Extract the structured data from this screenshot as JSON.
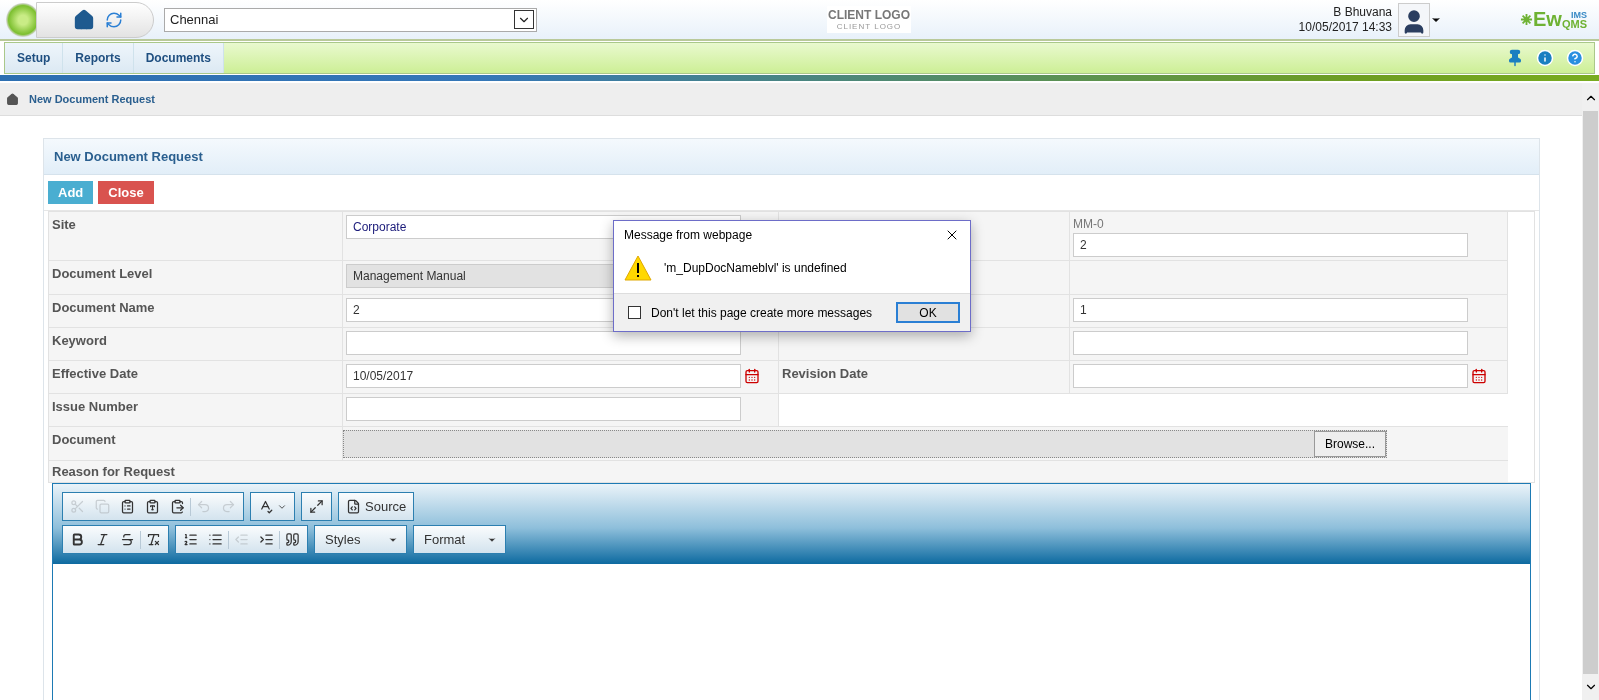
{
  "header": {
    "location": "Chennai",
    "client_logo": {
      "title": "CLIENT LOGO",
      "subtitle": "CLIENT LOGO"
    },
    "user": {
      "name": "B Bhuvana",
      "datetime": "10/05/2017 14:33"
    },
    "brand": {
      "main": "Ew",
      "sub": "QMS",
      "sup": "IMS"
    }
  },
  "nav": {
    "items": [
      {
        "label": "Setup",
        "selected": false
      },
      {
        "label": "Reports",
        "selected": false
      },
      {
        "label": "Documents",
        "selected": false
      }
    ]
  },
  "breadcrumb": {
    "current": "New Document Request"
  },
  "panel": {
    "title": "New Document Request",
    "buttons": [
      {
        "label": "Add",
        "kind": "primary"
      },
      {
        "label": "Close",
        "kind": "danger"
      }
    ],
    "rows": [
      {
        "left": {
          "label": "Site",
          "field": {
            "kind": "select",
            "value": "Corporate"
          }
        },
        "right": {
          "field": {
            "kind": "text",
            "caption": "MM-0",
            "value": "2"
          }
        }
      },
      {
        "left": {
          "label": "Document Level",
          "field": {
            "kind": "readonly",
            "value": "Management Manual"
          }
        },
        "right": {
          "field": {
            "kind": "none"
          }
        }
      },
      {
        "left": {
          "label": "Document Name",
          "field": {
            "kind": "text",
            "value": "2"
          }
        },
        "right": {
          "field": {
            "kind": "text",
            "value": "1"
          }
        }
      },
      {
        "left": {
          "label": "Keyword",
          "field": {
            "kind": "text"
          }
        },
        "right": {
          "field": {
            "kind": "text"
          }
        }
      },
      {
        "left": {
          "label": "Effective Date",
          "field": {
            "kind": "date",
            "value": "10/05/2017"
          }
        },
        "right": {
          "label": "Revision Date",
          "field": {
            "kind": "date"
          }
        }
      },
      {
        "left": {
          "label": "Issue Number",
          "field": {
            "kind": "text"
          }
        },
        "right": {
          "field": {
            "kind": "blank"
          }
        }
      }
    ],
    "document": {
      "label": "Document",
      "browse": "Browse..."
    },
    "reason": {
      "label": "Reason for Request"
    },
    "editor": {
      "row1": [
        [
          {
            "kind": "cut",
            "disabled": true
          },
          {
            "kind": "copy",
            "disabled": true
          },
          {
            "kind": "paste",
            "disabled": false
          },
          {
            "kind": "paste-text",
            "disabled": false
          },
          {
            "kind": "paste-word",
            "disabled": false
          },
          {
            "kind": "sep"
          },
          {
            "kind": "undo",
            "disabled": true
          },
          {
            "kind": "redo",
            "disabled": true
          }
        ],
        [
          {
            "kind": "spell",
            "disabled": false
          }
        ],
        [
          {
            "kind": "maximize",
            "disabled": false
          }
        ],
        [
          {
            "kind": "source",
            "label": "Source",
            "disabled": false
          }
        ]
      ],
      "row2": [
        [
          {
            "kind": "bold",
            "disabled": false
          },
          {
            "kind": "italic",
            "disabled": false
          },
          {
            "kind": "strike",
            "disabled": false
          },
          {
            "kind": "sep"
          },
          {
            "kind": "clear",
            "disabled": false
          }
        ],
        [
          {
            "kind": "ol",
            "disabled": false
          },
          {
            "kind": "ul",
            "disabled": false
          },
          {
            "kind": "sep"
          },
          {
            "kind": "outdent",
            "disabled": true
          },
          {
            "kind": "indent",
            "disabled": false
          },
          {
            "kind": "sep"
          },
          {
            "kind": "quote",
            "disabled": false
          }
        ]
      ],
      "combos": [
        "Styles",
        "Format"
      ]
    }
  },
  "dialog": {
    "title": "Message from webpage",
    "message": "'m_DupDocNameblvl' is undefined",
    "checkbox": {
      "label": "Don't let this page create more messages",
      "checked": false
    },
    "ok": "OK"
  }
}
